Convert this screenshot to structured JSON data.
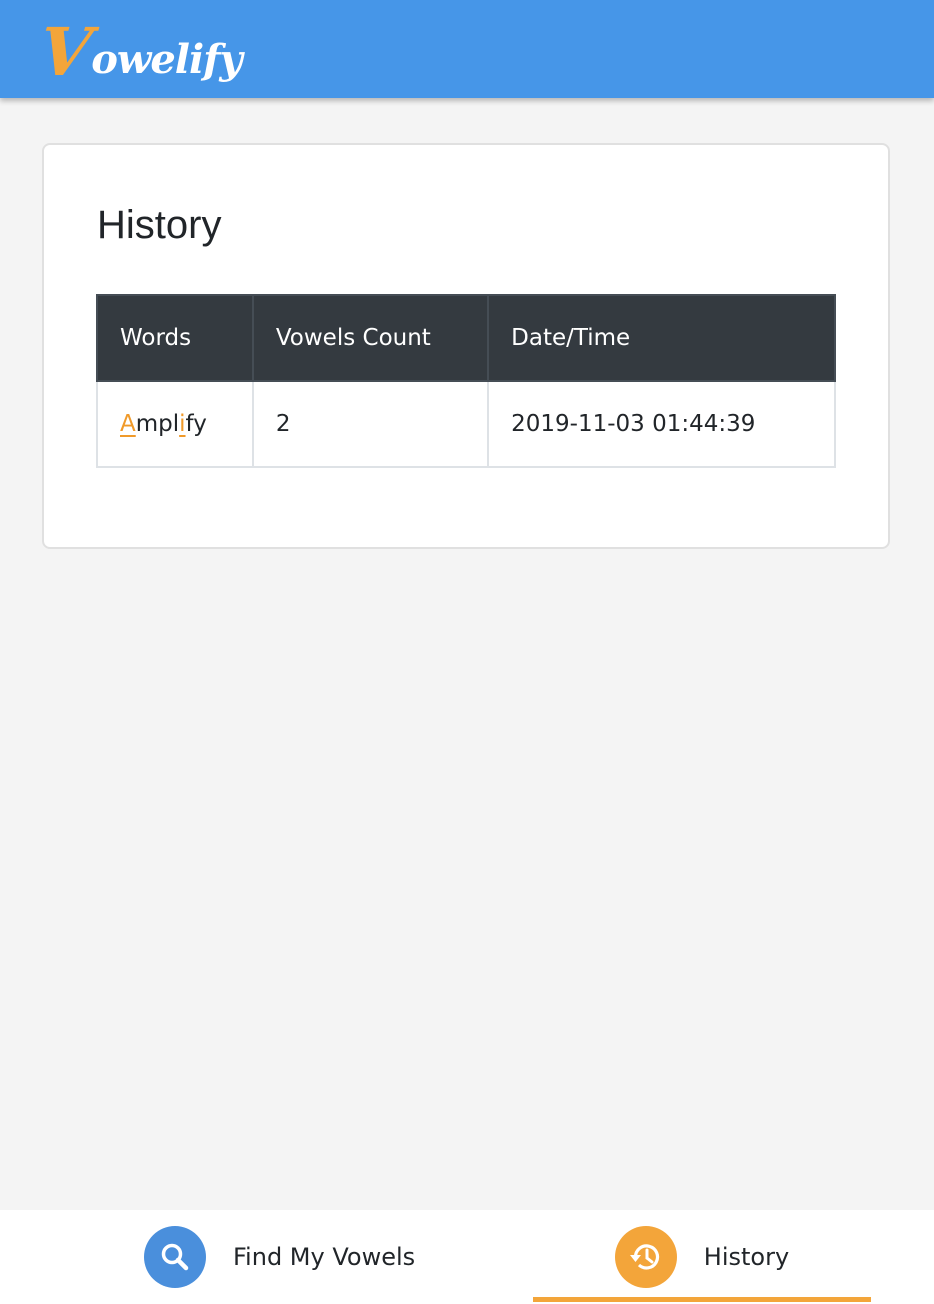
{
  "app": {
    "logo_initial": "V",
    "logo_rest": "owelify",
    "accent_color": "#f3a53a",
    "header_color": "#4696e8"
  },
  "history": {
    "title": "History",
    "columns": [
      "Words",
      "Vowels Count",
      "Date/Time"
    ],
    "rows": [
      {
        "word_parts": [
          "A",
          "mpl",
          "i",
          "fy"
        ],
        "vowels_count": "2",
        "datetime": "2019-11-03 01:44:39"
      }
    ]
  },
  "nav": {
    "find_label": "Find My Vowels",
    "find_icon": "search-icon",
    "history_label": "History",
    "history_icon": "history-icon",
    "active": "History"
  }
}
